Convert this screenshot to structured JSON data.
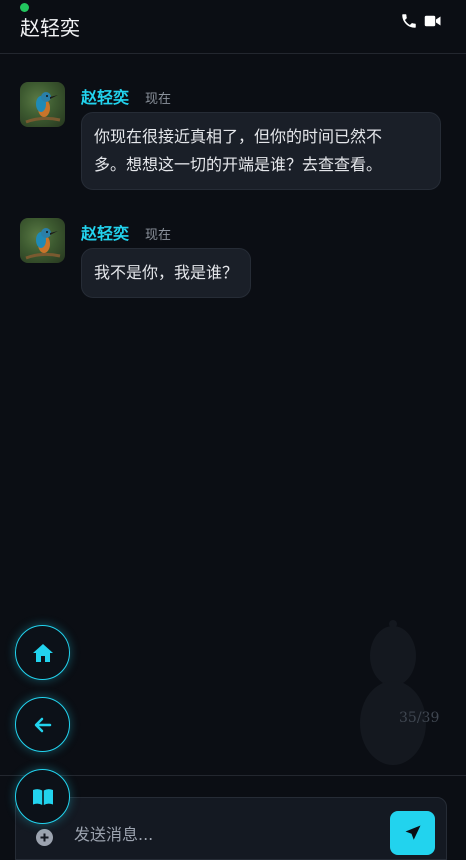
{
  "header": {
    "title": "赵轻奕",
    "online": true,
    "icons": [
      "phone-icon",
      "video-icon"
    ]
  },
  "messages": [
    {
      "sender": "赵轻奕",
      "time": "现在",
      "text_line1": "你现在很接近真相了，但你的时间已然不",
      "text_line2": "多。想想这一切的开端是谁？去查查看。"
    },
    {
      "sender": "赵轻奕",
      "time": "现在",
      "text_line1": "我不是你，我是谁？"
    }
  ],
  "side_buttons": [
    "home-icon",
    "back-arrow-icon",
    "book-icon"
  ],
  "progress": {
    "label": "35/39"
  },
  "composer": {
    "placeholder": "发送消息...",
    "icons": [
      "plus-icon",
      "send-icon"
    ]
  },
  "colors": {
    "background": "#0b0e14",
    "accent": "#22d3ee",
    "bubble": "#1a1f28",
    "online": "#22c55e"
  }
}
